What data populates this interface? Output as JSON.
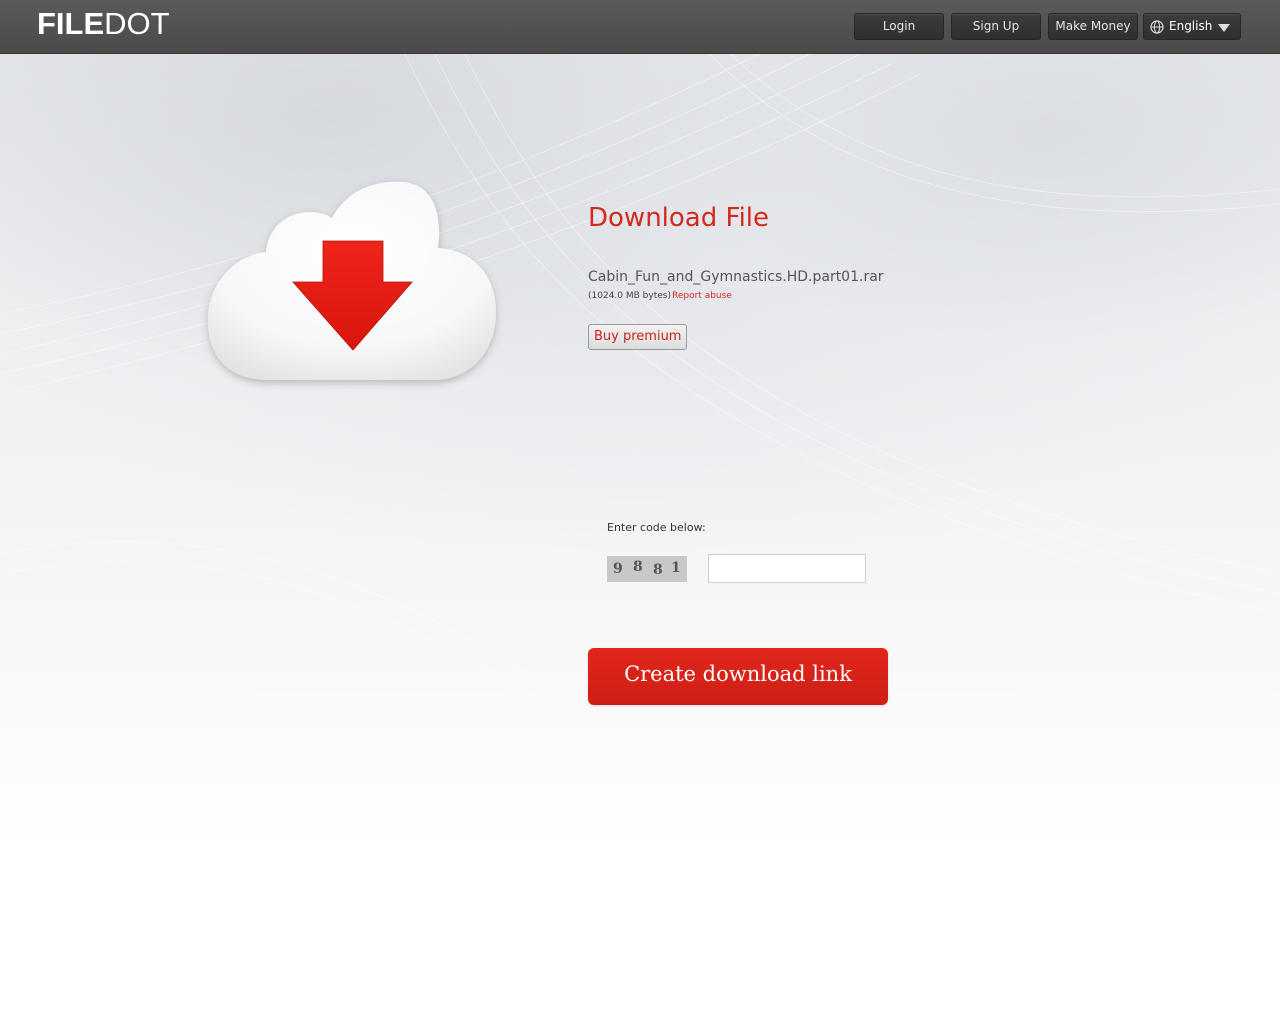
{
  "header": {
    "logo_bold": "FILE",
    "logo_light": "DOT",
    "nav": {
      "login": "Login",
      "signup": "Sign Up",
      "make_money": "Make Money",
      "language": "English"
    },
    "icons": {
      "language": "globe-icon",
      "language_dropdown": "chevron-down-icon"
    }
  },
  "main": {
    "illustration": "cloud-download-icon",
    "title": "Download File",
    "file_name": "Cabin_Fun_and_Gymnastics.HD.part01.rar",
    "file_size": "(1024.0 MB bytes)",
    "report_link": "Report abuse",
    "buy_premium": "Buy premium",
    "captcha": {
      "label": "Enter code below:",
      "digits": [
        "9",
        "8",
        "8",
        "1"
      ],
      "input_value": "",
      "input_placeholder": ""
    },
    "create_link_button": "Create download link"
  },
  "colors": {
    "accent": "#d42a1e",
    "header_bg": "#505050",
    "button_red": "#dc241a"
  }
}
